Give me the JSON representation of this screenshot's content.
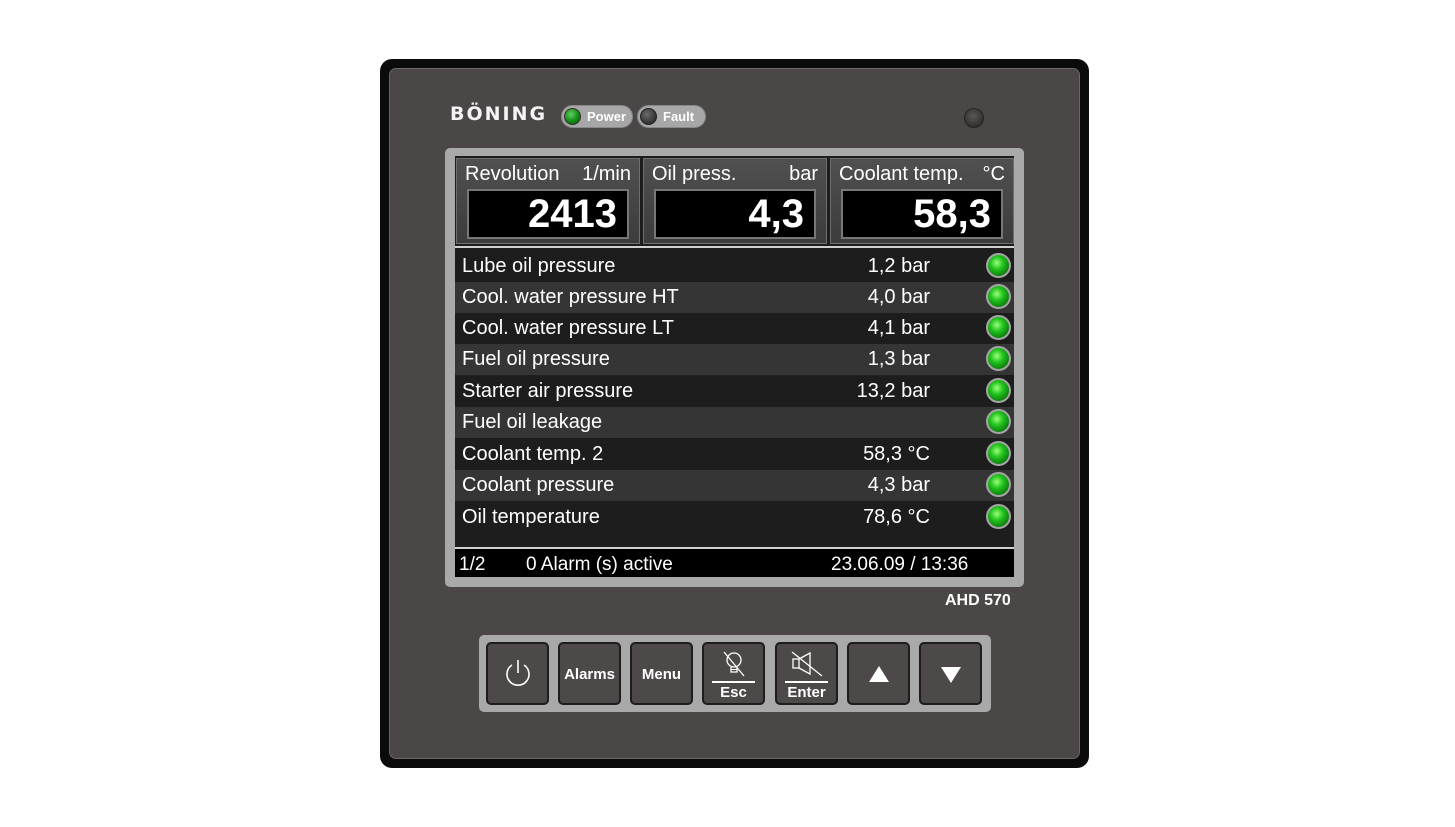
{
  "header": {
    "brand": "BÖNING",
    "power_label": "Power",
    "fault_label": "Fault"
  },
  "gauges": [
    {
      "label": "Revolution",
      "unit": "1/min",
      "value": "2413"
    },
    {
      "label": "Oil press.",
      "unit": "bar",
      "value": "4,3"
    },
    {
      "label": "Coolant temp.",
      "unit": "°C",
      "value": "58,3"
    }
  ],
  "rows": [
    {
      "label": "Lube oil pressure",
      "value": "1,2 bar"
    },
    {
      "label": "Cool. water pressure HT",
      "value": "4,0 bar"
    },
    {
      "label": "Cool. water pressure LT",
      "value": "4,1 bar"
    },
    {
      "label": "Fuel oil pressure",
      "value": "1,3 bar"
    },
    {
      "label": "Starter air pressure",
      "value": "13,2 bar"
    },
    {
      "label": "Fuel oil leakage",
      "value": ""
    },
    {
      "label": "Coolant temp. 2",
      "value": "58,3 °C"
    },
    {
      "label": "Coolant pressure",
      "value": "4,3 bar"
    },
    {
      "label": "Oil temperature",
      "value": "78,6 °C"
    }
  ],
  "status": {
    "page": "1/2",
    "alarms": "0 Alarm (s) active",
    "datetime": "23.06.09 / 13:36"
  },
  "model": "AHD 570",
  "keys": {
    "alarms": "Alarms",
    "menu": "Menu",
    "esc": "Esc",
    "enter": "Enter"
  },
  "colors": {
    "status_ok": "#23c51f",
    "panel": "#4a4746",
    "screen": "#1d1d1d"
  }
}
